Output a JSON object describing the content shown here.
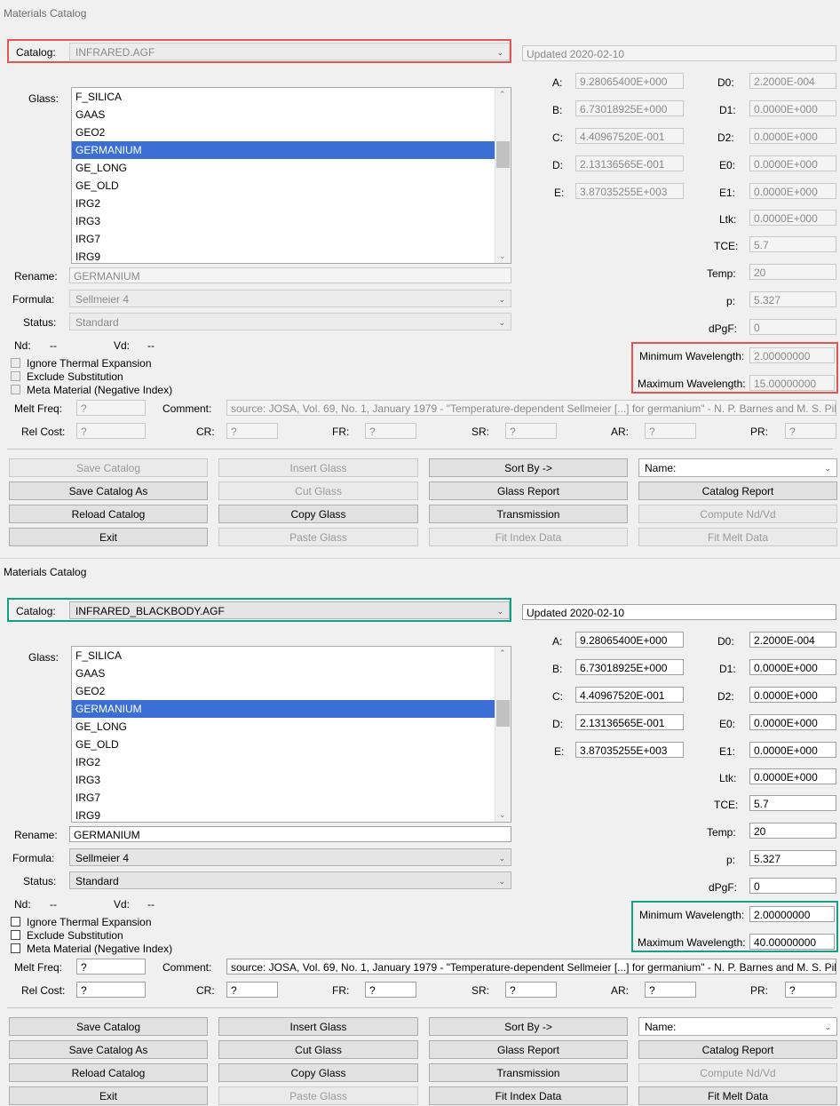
{
  "window_title": "Materials Catalog",
  "labels": {
    "catalog": "Catalog:",
    "glass": "Glass:",
    "rename": "Rename:",
    "formula": "Formula:",
    "status": "Status:",
    "nd": "Nd:",
    "vd": "Vd:",
    "nd_val": "--",
    "vd_val": "--",
    "ignore_thermal": "Ignore Thermal Expansion",
    "exclude_sub": "Exclude Substitution",
    "meta_material": "Meta Material (Negative Index)",
    "melt_freq": "Melt Freq:",
    "comment": "Comment:",
    "rel_cost": "Rel Cost:",
    "cr": "CR:",
    "fr": "FR:",
    "sr": "SR:",
    "ar": "AR:",
    "pr": "PR:",
    "a": "A:",
    "b": "B:",
    "c": "C:",
    "d": "D:",
    "e": "E:",
    "d0": "D0:",
    "d1": "D1:",
    "d2": "D2:",
    "e0": "E0:",
    "e1": "E1:",
    "ltk": "Ltk:",
    "tce": "TCE:",
    "temp": "Temp:",
    "p": "p:",
    "dpgf": "dPgF:",
    "min_wl": "Minimum Wavelength:",
    "max_wl": "Maximum Wavelength:"
  },
  "glass_list": [
    "F_SILICA",
    "GAAS",
    "GEO2",
    "GERMANIUM",
    "GE_LONG",
    "GE_OLD",
    "IRG2",
    "IRG3",
    "IRG7",
    "IRG9"
  ],
  "buttons": {
    "save_catalog": "Save Catalog",
    "insert_glass": "Insert Glass",
    "sort_by": "Sort By ->",
    "sort_name": "Name:",
    "save_catalog_as": "Save Catalog As",
    "cut_glass": "Cut Glass",
    "glass_report": "Glass Report",
    "catalog_report": "Catalog Report",
    "reload_catalog": "Reload Catalog",
    "copy_glass": "Copy Glass",
    "transmission": "Transmission",
    "compute_nd_vd": "Compute Nd/Vd",
    "exit": "Exit",
    "paste_glass": "Paste Glass",
    "fit_index_data": "Fit Index Data",
    "fit_melt_data": "Fit Melt Data"
  },
  "panel1": {
    "catalog": "INFRARED.AGF",
    "updated": "Updated 2020-02-10",
    "rename": "GERMANIUM",
    "formula": "Sellmeier 4",
    "status": "Standard",
    "A": "9.28065400E+000",
    "B": "6.73018925E+000",
    "C": "4.40967520E-001",
    "D": "2.13136565E-001",
    "E": "3.87035255E+003",
    "D0": "2.2000E-004",
    "D1": "0.0000E+000",
    "D2": "0.0000E+000",
    "E0": "0.0000E+000",
    "E1": "0.0000E+000",
    "Ltk": "0.0000E+000",
    "TCE": "5.7",
    "Temp": "20",
    "p": "5.327",
    "dPgF": "0",
    "min_wl": "2.00000000",
    "max_wl": "15.00000000",
    "melt_freq": "?",
    "comment": "source:  JOSA, Vol. 69, No. 1, January 1979 - \"Temperature-dependent Sellmeier [...] for germanium\" - N. P. Barnes and M. S. Piltch",
    "rel_cost": "?",
    "cr": "?",
    "fr": "?",
    "sr": "?",
    "ar": "?",
    "pr": "?"
  },
  "panel2": {
    "catalog": "INFRARED_BLACKBODY.AGF",
    "updated": "Updated 2020-02-10",
    "rename": "GERMANIUM",
    "formula": "Sellmeier 4",
    "status": "Standard",
    "A": "9.28065400E+000",
    "B": "6.73018925E+000",
    "C": "4.40967520E-001",
    "D": "2.13136565E-001",
    "E": "3.87035255E+003",
    "D0": "2.2000E-004",
    "D1": "0.0000E+000",
    "D2": "0.0000E+000",
    "E0": "0.0000E+000",
    "E1": "0.0000E+000",
    "Ltk": "0.0000E+000",
    "TCE": "5.7",
    "Temp": "20",
    "p": "5.327",
    "dPgF": "0",
    "min_wl": "2.00000000",
    "max_wl": "40.00000000",
    "melt_freq": "?",
    "comment": "source:  JOSA, Vol. 69, No. 1, January 1979 - \"Temperature-dependent Sellmeier [...] for germanium\" - N. P. Barnes and M. S. Piltch",
    "rel_cost": "?",
    "cr": "?",
    "fr": "?",
    "sr": "?",
    "ar": "?",
    "pr": "?"
  },
  "highlight_colors": {
    "panel1": "#e05555",
    "panel2": "#13a085"
  }
}
